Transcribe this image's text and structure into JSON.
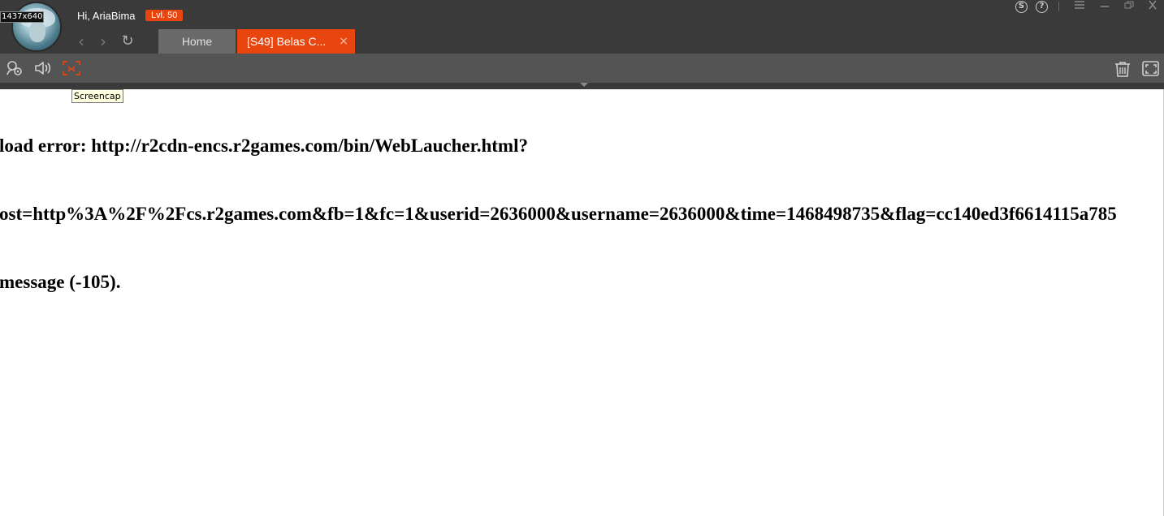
{
  "window": {
    "size_badge": "1437x640",
    "user": {
      "greeting": "Hi, AriaBima",
      "level": "Lvl. 50"
    },
    "window_controls": [
      "coin-icon",
      "help-icon",
      "menu-icon",
      "minimize-icon",
      "restore-icon",
      "close-icon"
    ]
  },
  "nav": {
    "back_icon": "‹",
    "forward_icon": "›",
    "refresh_icon": "↻"
  },
  "tabs": [
    {
      "label": "Home",
      "active": false
    },
    {
      "label": "[S49] Belas C...",
      "active": true,
      "close": "×"
    }
  ],
  "toolbar": {
    "left_tools": [
      "user-settings-icon",
      "volume-icon",
      "screencap-icon"
    ],
    "right_tools": [
      "trash-icon",
      "fullscreen-icon"
    ],
    "tooltip": "Screencap"
  },
  "page": {
    "error_lines": [
      "load error: http://r2cdn-encs.r2games.com/bin/WebLaucher.html?",
      "ost=http%3A%2F%2Fcs.r2games.com&fb=1&fc=1&userid=2636000&username=2636000&time=1468498735&flag=cc140ed3f6614115a785",
      "message (-105)."
    ]
  },
  "colors": {
    "accent": "#e8450f",
    "titlebar": "#3a3a3a",
    "toolbar": "#545454"
  }
}
